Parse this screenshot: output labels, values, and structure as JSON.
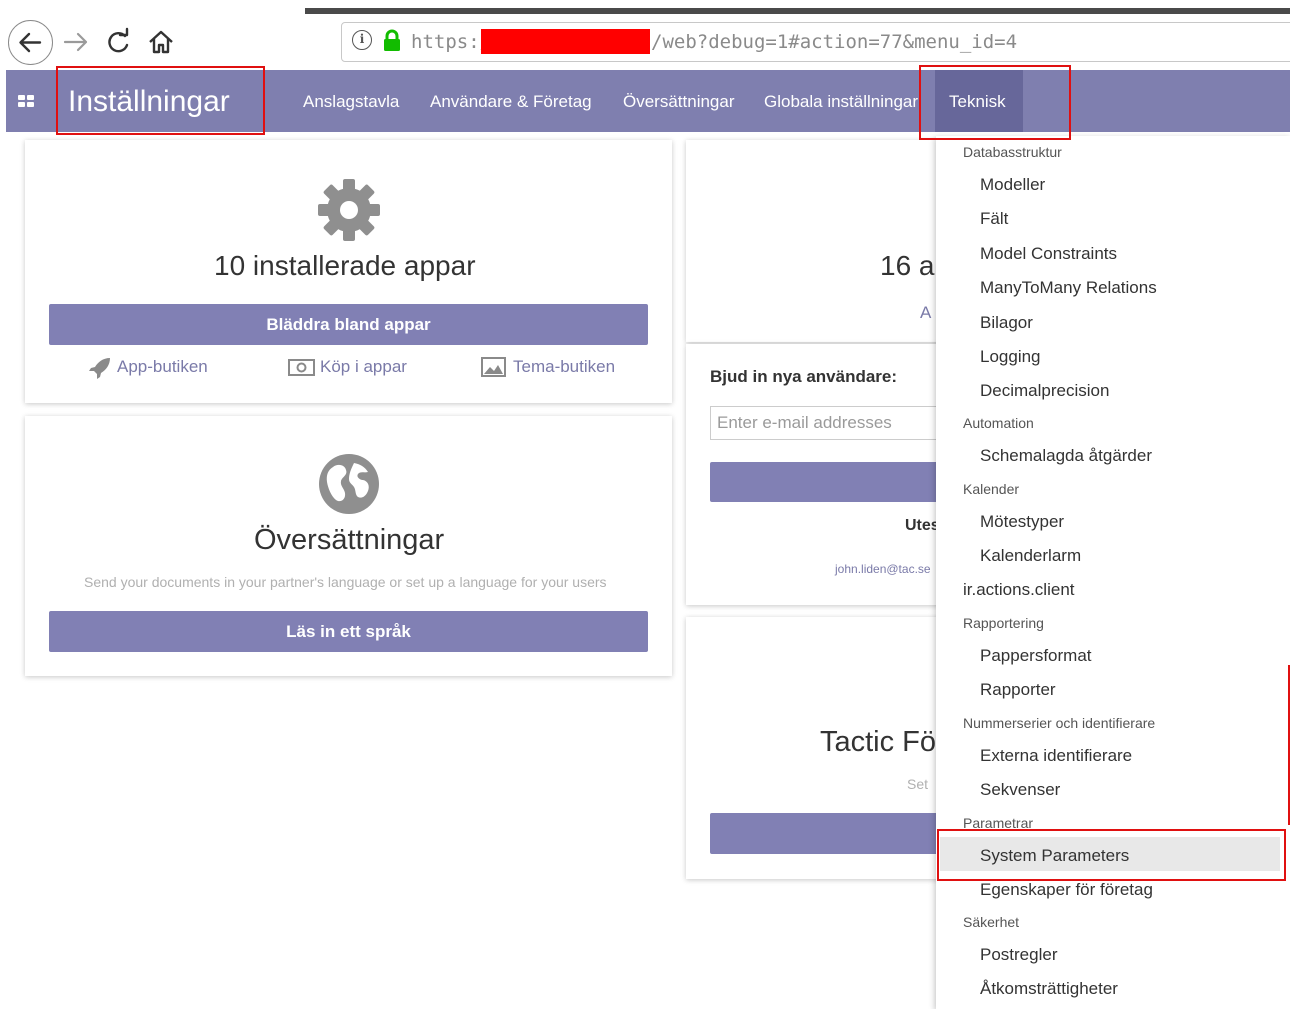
{
  "browser": {
    "url_prefix": "https://",
    "url_suffix": "/web?debug=1#action=77&menu_id=4",
    "back_icon": "arrow-left-icon",
    "forward_icon": "arrow-right-icon",
    "reload_icon": "reload-icon",
    "home_icon": "home-icon"
  },
  "navbar": {
    "brand": "Inställningar",
    "menu": [
      "Anslagstavla",
      "Användare & Företag",
      "Översättningar",
      "Globala inställningar",
      "Teknisk"
    ],
    "color": "#7f7faf",
    "active_color": "#67679a"
  },
  "apps_card": {
    "icon": "gear-icon",
    "title": "10 installerade appar",
    "button": "Bläddra bland appar",
    "links": [
      "App-butiken",
      "Köp i appar",
      "Tema-butiken"
    ]
  },
  "translations_card": {
    "icon": "globe-icon",
    "title": "Översättningar",
    "subtitle": "Send your documents in your partner's language or set up a language for your users",
    "button": "Läs in ett språk"
  },
  "users_card": {
    "title_partial": "16 a",
    "link_partial": "A",
    "invite_label": "Bjud in nya användare:",
    "email_placeholder": "Enter e-mail addresses",
    "pending_partial": "Utes",
    "pending_email_partial": "john.liden@tac.se"
  },
  "company_card": {
    "title_partial": "Tactic Fö",
    "subtitle_partial": "Set"
  },
  "dropdown": {
    "sections": [
      {
        "header": "Databasstruktur",
        "items": [
          "Modeller",
          "Fält",
          "Model Constraints",
          "ManyToMany Relations",
          "Bilagor",
          "Logging",
          "Decimalprecision"
        ]
      },
      {
        "header": "Automation",
        "items": [
          "Schemalagda åtgärder"
        ]
      },
      {
        "header": "Kalender",
        "items": [
          "Mötestyper",
          "Kalenderlarm"
        ]
      },
      {
        "header": "ir.actions.client",
        "items": []
      },
      {
        "header": "Rapportering",
        "items": [
          "Pappersformat",
          "Rapporter"
        ]
      },
      {
        "header": "Nummerserier och identifierare",
        "items": [
          "Externa identifierare",
          "Sekvenser"
        ]
      },
      {
        "header": "Parametrar",
        "items": [
          "System Parameters",
          "Egenskaper för företag"
        ]
      },
      {
        "header": "Säkerhet",
        "items": [
          "Postregler",
          "Åtkomsträttigheter"
        ]
      }
    ],
    "highlighted": "System Parameters"
  }
}
